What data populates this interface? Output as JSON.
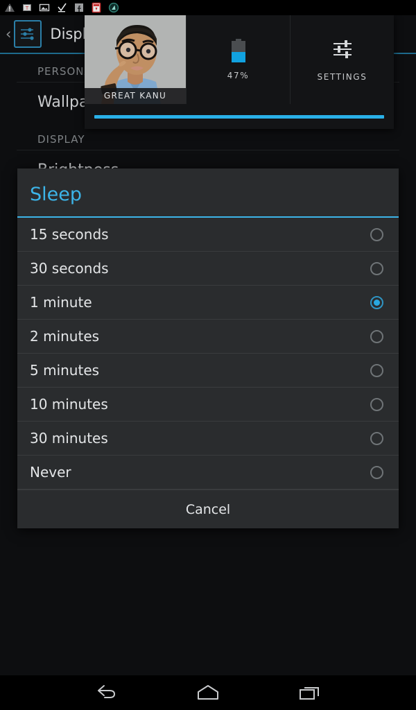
{
  "status_bar": {
    "icons": [
      {
        "name": "warning-triangle-icon",
        "label": "warning"
      },
      {
        "name": "text-app-icon",
        "label": "text"
      },
      {
        "name": "image-icon",
        "label": "image"
      },
      {
        "name": "checkmark-icon",
        "label": "check"
      },
      {
        "name": "facebook-icon",
        "label": "facebook"
      },
      {
        "name": "pdf-icon",
        "label": "pdf"
      },
      {
        "name": "opera-circle-icon",
        "label": "browser"
      }
    ]
  },
  "settings_page": {
    "back_label": "‹",
    "app_icon": "sliders-icon",
    "title": "Display",
    "sections": [
      {
        "header": "PERSONALIZE",
        "rows": [
          "Wallpaper"
        ]
      },
      {
        "header": "DISPLAY",
        "rows": [
          "Brightness"
        ]
      }
    ]
  },
  "notification_shade": {
    "user_tile": {
      "name": "GREAT KANU"
    },
    "battery_tile": {
      "percent_label": "47%",
      "percent": 47
    },
    "settings_tile": {
      "label": "SETTINGS",
      "icon": "sliders-icon"
    }
  },
  "dialog": {
    "title": "Sleep",
    "options": [
      {
        "label": "15 seconds",
        "selected": false
      },
      {
        "label": "30 seconds",
        "selected": false
      },
      {
        "label": "1 minute",
        "selected": true
      },
      {
        "label": "2 minutes",
        "selected": false
      },
      {
        "label": "5 minutes",
        "selected": false
      },
      {
        "label": "10 minutes",
        "selected": false
      },
      {
        "label": "30 minutes",
        "selected": false
      },
      {
        "label": "Never",
        "selected": false
      }
    ],
    "cancel_label": "Cancel"
  },
  "nav_bar": {
    "back": "back-icon",
    "home": "home-icon",
    "recents": "recents-icon"
  },
  "colors": {
    "accent": "#3cb4e8",
    "dialog_bg": "#2a2c2e",
    "page_bg": "#0d0e10",
    "radio_on": "#29a8e0"
  }
}
